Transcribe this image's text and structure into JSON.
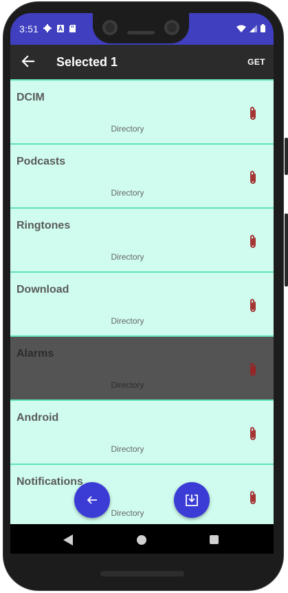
{
  "status_bar": {
    "time": "3:51",
    "icons": [
      "gear-icon",
      "a-icon",
      "sd-card-icon"
    ],
    "right_icons": [
      "wifi-icon",
      "signal-icon",
      "battery-icon"
    ]
  },
  "toolbar": {
    "title": "Selected 1",
    "get_label": "GET"
  },
  "list": {
    "items": [
      {
        "name": "DCIM",
        "type": "Directory",
        "selected": false
      },
      {
        "name": "Podcasts",
        "type": "Directory",
        "selected": false
      },
      {
        "name": "Ringtones",
        "type": "Directory",
        "selected": false
      },
      {
        "name": "Download",
        "type": "Directory",
        "selected": false
      },
      {
        "name": "Alarms",
        "type": "Directory",
        "selected": true
      },
      {
        "name": "Android",
        "type": "Directory",
        "selected": false
      },
      {
        "name": "Notifications",
        "type": "Directory",
        "selected": false
      }
    ]
  },
  "fabs": {
    "back_icon": "arrow-left-icon",
    "import_icon": "download-box-icon"
  },
  "colors": {
    "status_bar": "#3f3fbf",
    "toolbar": "#2b2b2b",
    "row_bg": "#cffcee",
    "row_border": "#5fe3b8",
    "row_selected": "#545454",
    "fab": "#3b3bd6",
    "clip": "#a02020"
  }
}
